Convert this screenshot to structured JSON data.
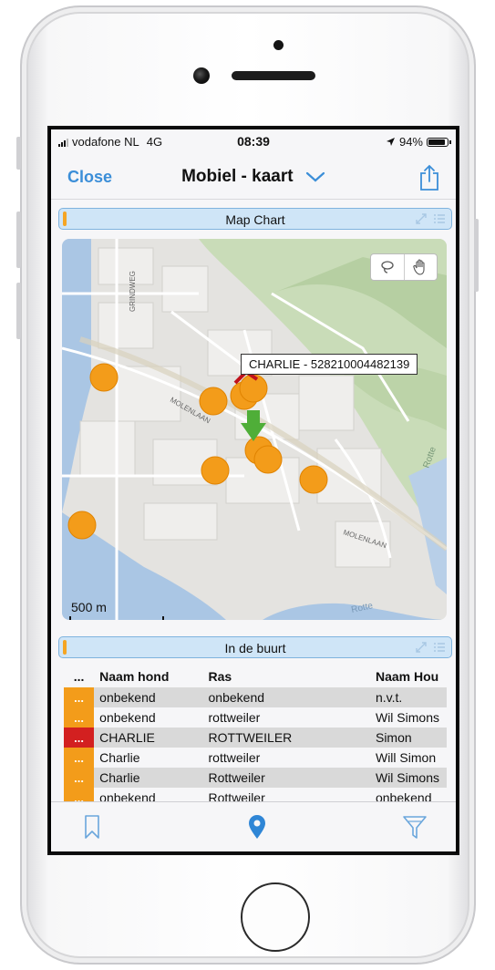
{
  "status_bar": {
    "carrier": "vodafone NL",
    "network": "4G",
    "time": "08:39",
    "battery": "94%"
  },
  "navbar": {
    "close_label": "Close",
    "title": "Mobiel - kaart"
  },
  "map_panel": {
    "title": "Map Chart",
    "tooltip": "CHARLIE - 528210004482139",
    "scale_label": "500 m",
    "street_labels": [
      "GRINDWEG",
      "MOLENLAAN",
      "MOLENLAAN",
      "Rotte",
      "Rotte"
    ]
  },
  "table_panel": {
    "title": "In de buurt",
    "columns": [
      "...",
      "Naam hond",
      "Ras",
      "Naam Hou"
    ],
    "rows": [
      {
        "marker": "...",
        "naam": "onbekend",
        "ras": "onbekend",
        "houder": "n.v.t.",
        "color": "#f39c1a"
      },
      {
        "marker": "...",
        "naam": "onbekend",
        "ras": "rottweiler",
        "houder": "Wil Simons",
        "color": "#f39c1a"
      },
      {
        "marker": "...",
        "naam": "CHARLIE",
        "ras": "ROTTWEILER",
        "houder": "Simon",
        "color": "#d32020"
      },
      {
        "marker": "...",
        "naam": "Charlie",
        "ras": "rottweiler",
        "houder": "Will Simon",
        "color": "#f39c1a"
      },
      {
        "marker": "...",
        "naam": "Charlie",
        "ras": "Rottweiler",
        "houder": "Wil Simons",
        "color": "#f39c1a"
      },
      {
        "marker": "...",
        "naam": "onbekend",
        "ras": "Rottweiler",
        "houder": "onbekend",
        "color": "#f39c1a"
      }
    ]
  },
  "tabbar": {
    "icons": [
      "bookmark-icon",
      "location-pin-icon",
      "filter-icon"
    ],
    "active": "location-pin-icon"
  },
  "colors": {
    "accent_blue": "#3b8ed8",
    "marker_orange": "#f39c1a",
    "marker_red": "#d32020",
    "header_blue": "#cfe5f7"
  }
}
